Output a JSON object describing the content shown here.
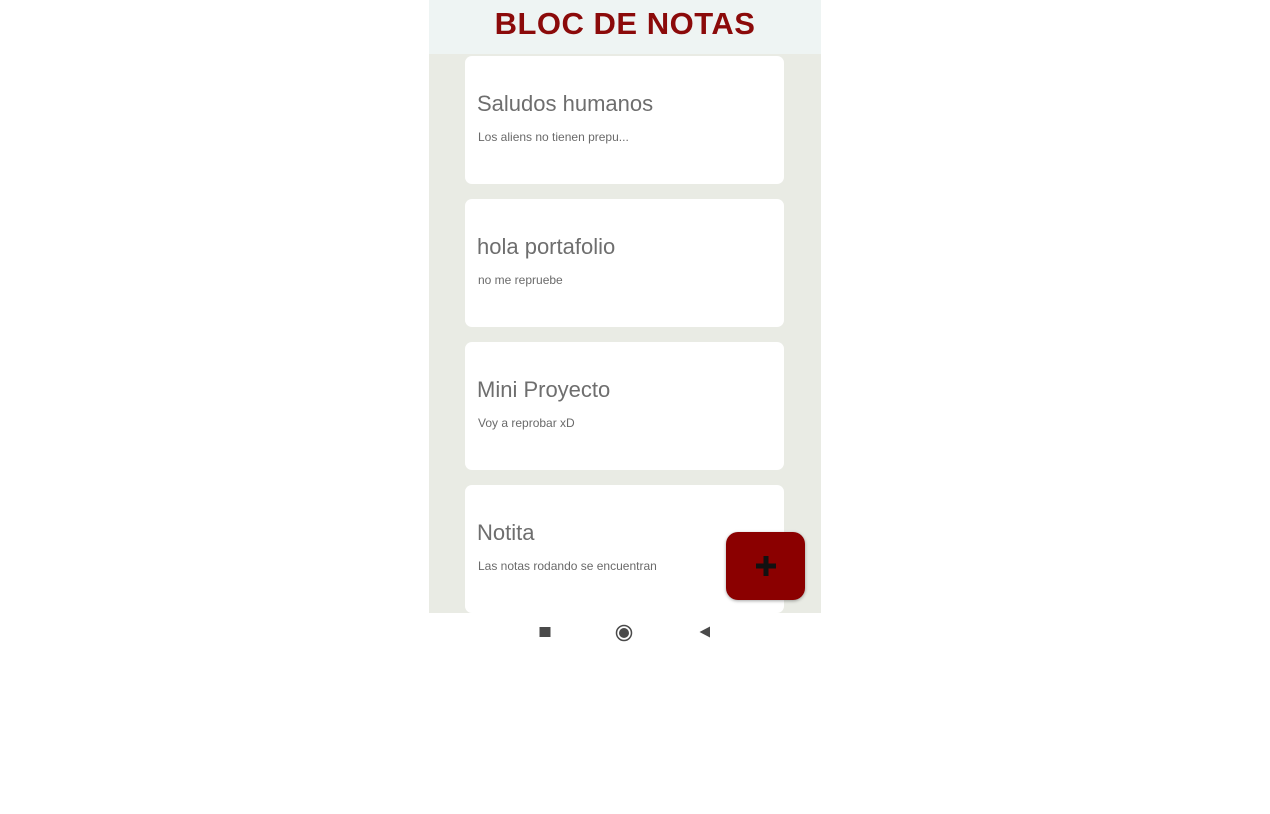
{
  "app": {
    "title": "BLOC DE NOTAS"
  },
  "notes": [
    {
      "title": "Saludos humanos",
      "preview": "Los aliens no tienen prepu..."
    },
    {
      "title": "hola portafolio",
      "preview": "no me repruebe"
    },
    {
      "title": "Mini Proyecto",
      "preview": "Voy a reprobar xD"
    },
    {
      "title": "Notita",
      "preview": "Las notas rodando se encuentran"
    }
  ],
  "fab": {
    "icon": "plus-icon",
    "color": "#8b0000"
  },
  "nav_bar": {
    "icons": [
      "recents-square-icon",
      "home-circle-icon",
      "back-triangle-icon"
    ]
  },
  "colors": {
    "title": "#8b0a0a",
    "header_background": "#eef4f3",
    "list_background": "#e9ebe4",
    "card_background": "#ffffff"
  }
}
